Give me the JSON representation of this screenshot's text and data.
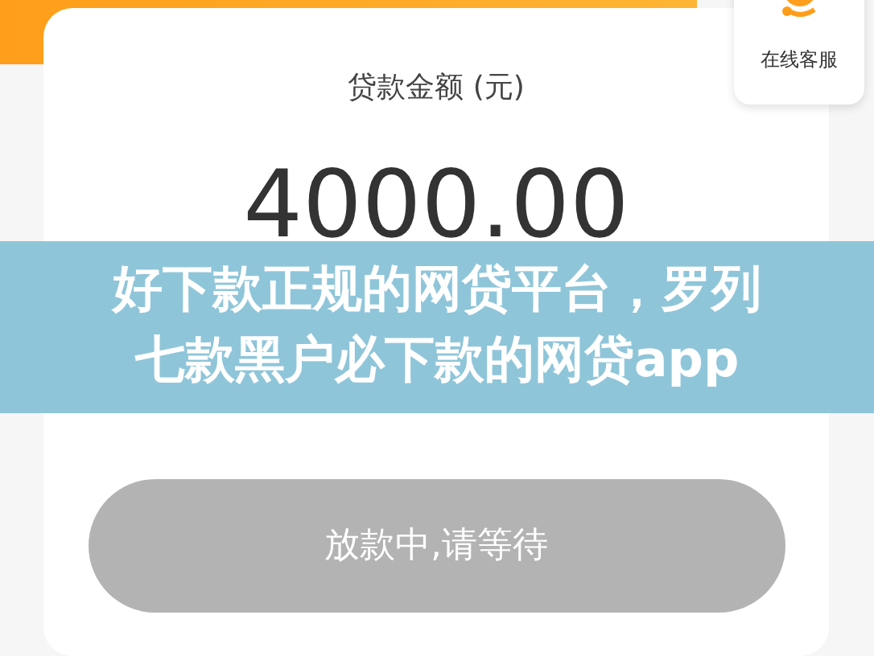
{
  "loan_card": {
    "label": "贷款金额 (元)",
    "amount": "4000.00"
  },
  "customer_service": {
    "label": "在线客服"
  },
  "banner": {
    "title": "好下款正规的网贷平台，罗列七款黑户必下款的网贷app"
  },
  "status_button": {
    "label": "放款中,请等待",
    "disabled": true
  }
}
